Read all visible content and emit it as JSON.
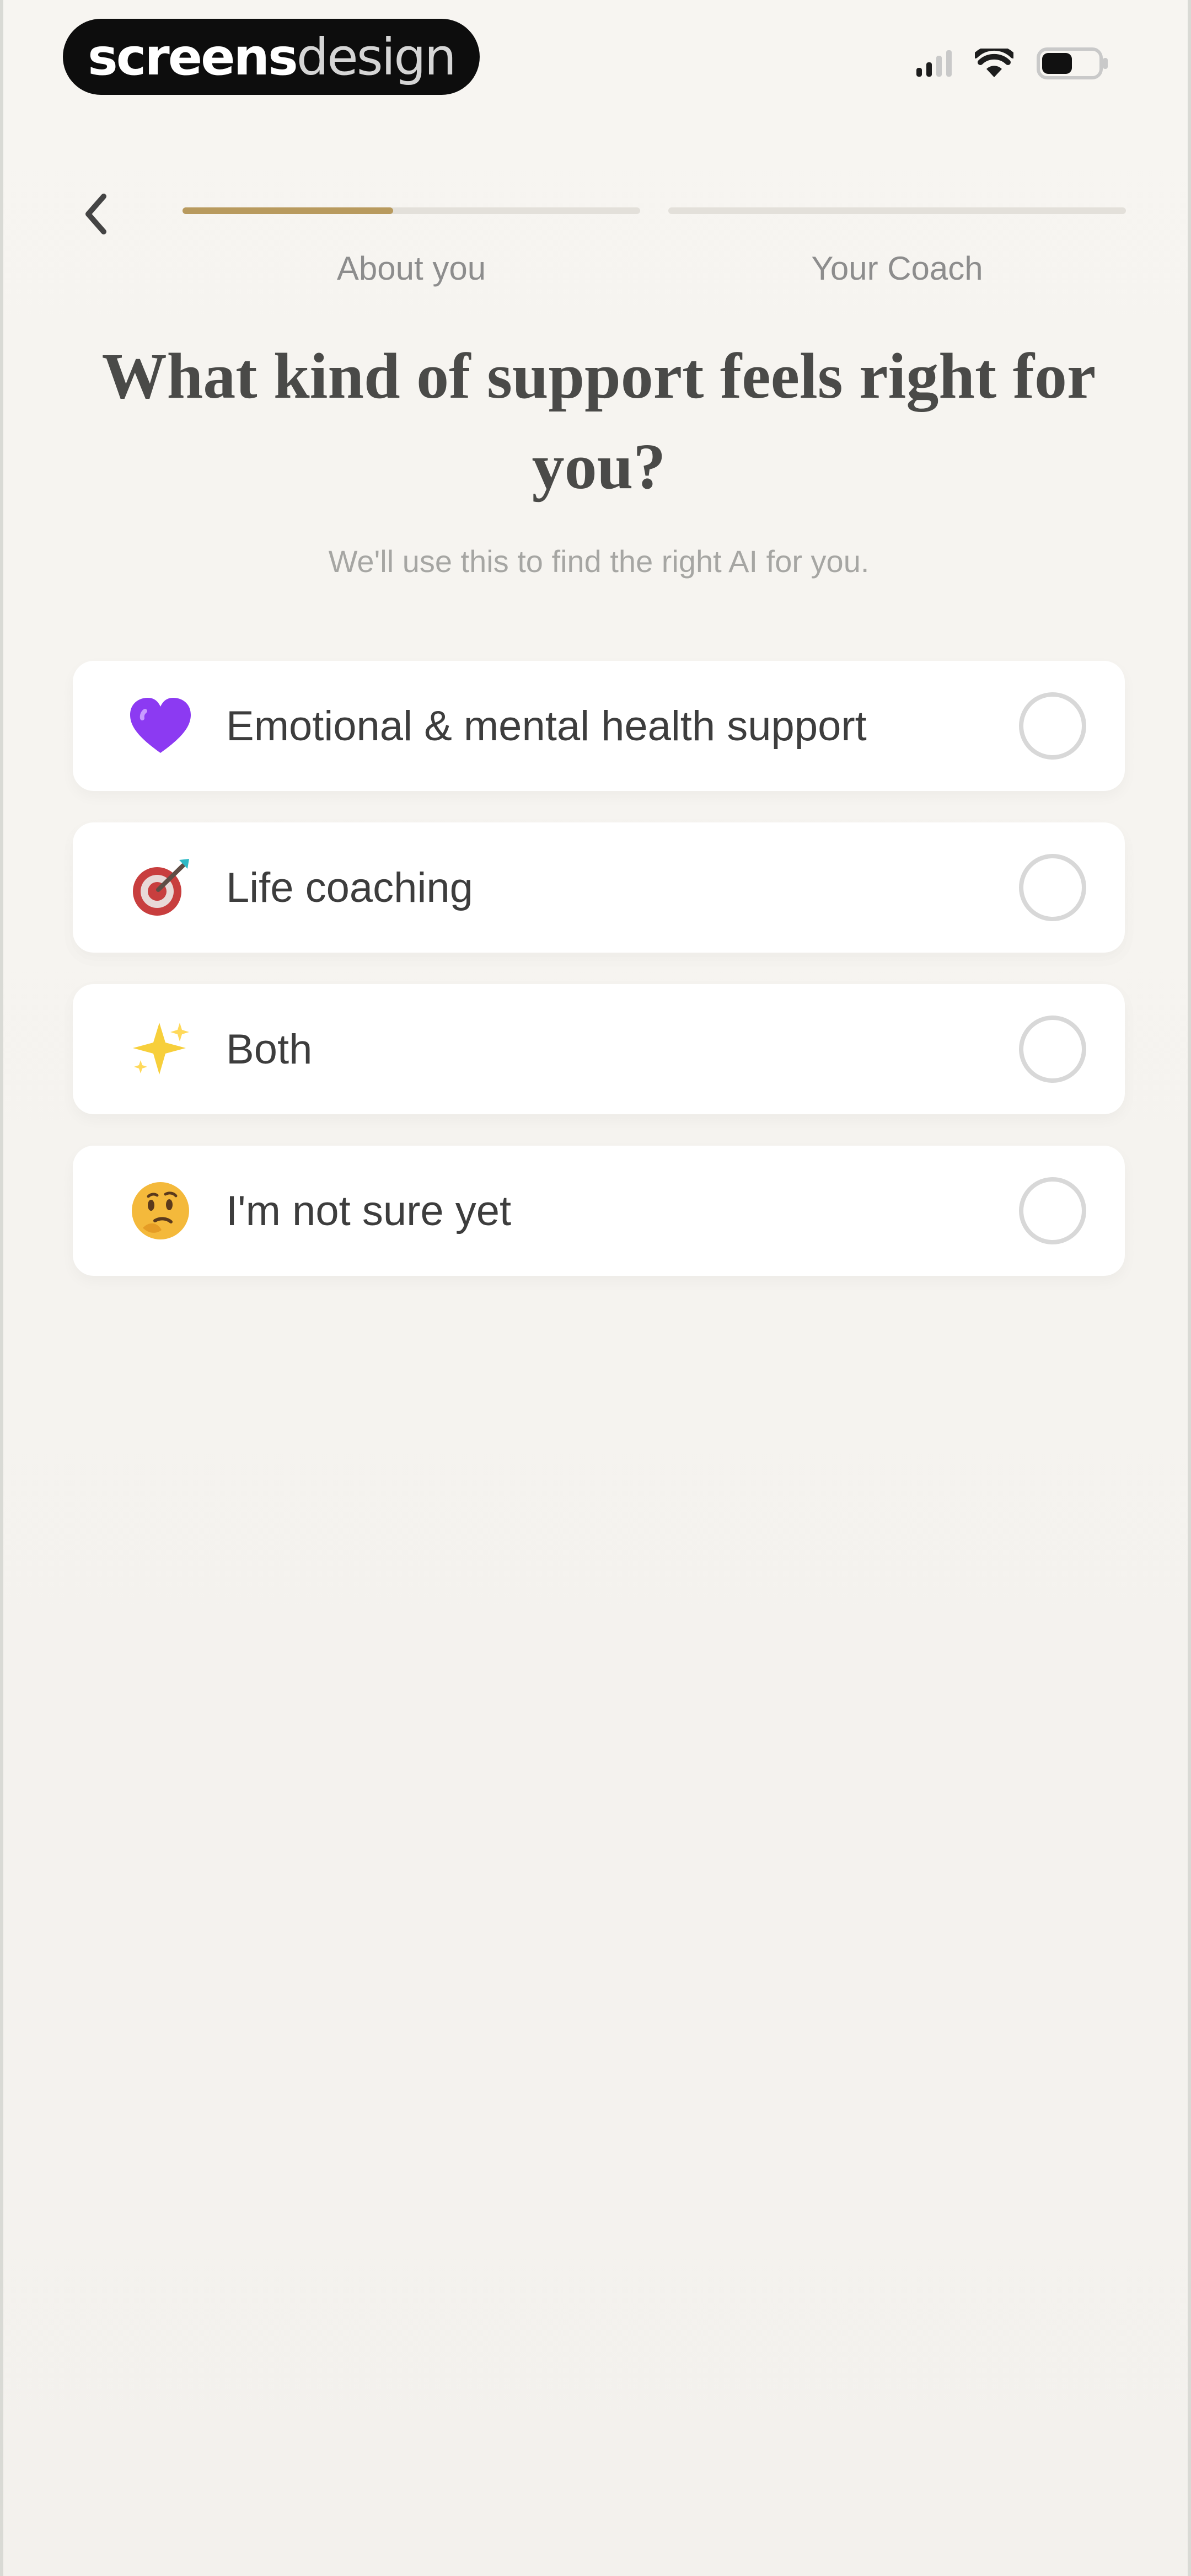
{
  "status_bar": {
    "brand_bold": "screens",
    "brand_light": "design",
    "signal_icon": "signal-icon",
    "wifi_icon": "wifi-icon",
    "battery_icon": "battery-icon"
  },
  "header": {
    "back_icon": "chevron-left-icon",
    "steps": [
      {
        "label": "About you",
        "progress": 0.46
      },
      {
        "label": "Your Coach",
        "progress": 0
      }
    ]
  },
  "main": {
    "title": "What kind of support feels right for you?",
    "subtitle": "We'll use this to find the right AI for you.",
    "options": [
      {
        "label": "Emotional & mental health support",
        "icon": "purple-heart-icon",
        "selected": false
      },
      {
        "label": "Life coaching",
        "icon": "dart-target-icon",
        "selected": false
      },
      {
        "label": "Both",
        "icon": "sparkles-icon",
        "selected": false
      },
      {
        "label": "I'm not sure yet",
        "icon": "thinking-face-icon",
        "selected": false
      }
    ]
  },
  "colors": {
    "background": "#f4f2ee",
    "accent": "#b89a5e",
    "card": "#ffffff",
    "track": "#e3e0da",
    "radio_border": "#d8d8d8"
  }
}
